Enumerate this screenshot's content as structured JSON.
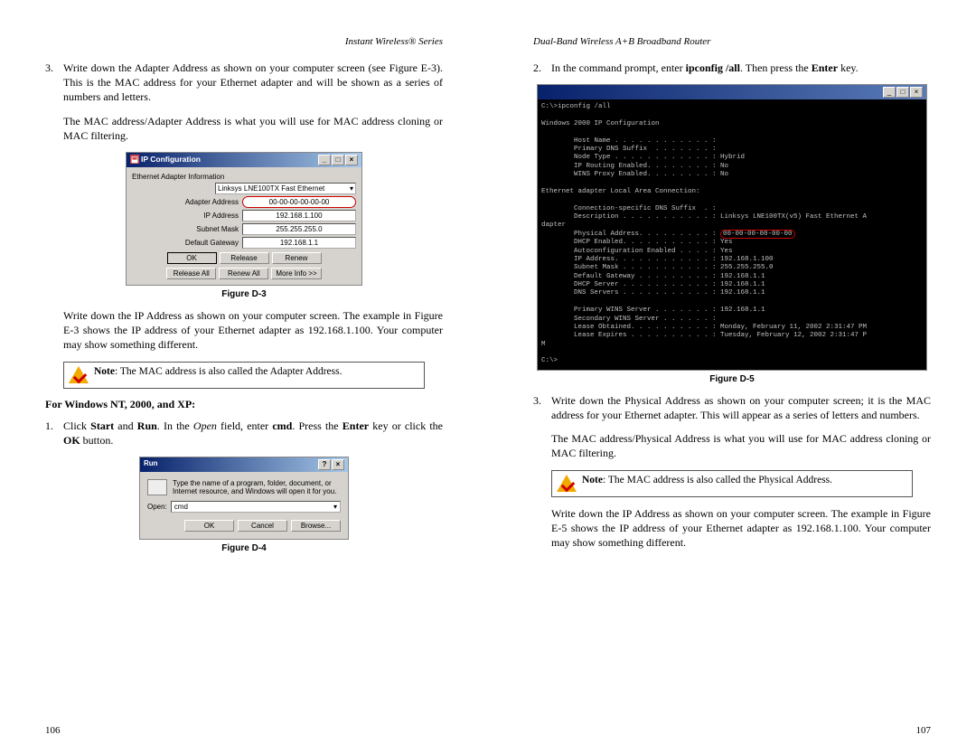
{
  "left": {
    "header": "Instant Wireless® Series",
    "step3_a": "Write down the Adapter Address as shown on your computer screen (see Figure E-3). This is the MAC address for your Ethernet adapter and will be shown as a series of numbers and letters.",
    "step3_b": "The MAC address/Adapter Address is what you will use for MAC address cloning or MAC filtering.",
    "d3_caption": "Figure D-3",
    "d3_title": "IP Configuration",
    "d3_group": "Ethernet Adapter Information",
    "d3_dd": "Linksys LNE100TX Fast Ethernet",
    "d3_r1l": "Adapter Address",
    "d3_r1v": "00-00-00-00-00-00",
    "d3_r2l": "IP Address",
    "d3_r2v": "192.168.1.100",
    "d3_r3l": "Subnet Mask",
    "d3_r3v": "255.255.255.0",
    "d3_r4l": "Default Gateway",
    "d3_r4v": "192.168.1.1",
    "d3_b1": "OK",
    "d3_b2": "Release",
    "d3_b3": "Renew",
    "d3_b4": "Release All",
    "d3_b5": "Renew All",
    "d3_b6": "More Info >>",
    "after_d3": "Write down the IP Address as shown on your computer screen. The example in Figure E-3 shows the IP address of your Ethernet adapter as 192.168.1.100. Your computer may show something different.",
    "note1_pre": "Note",
    "note1_text": ": The MAC address is also called the Adapter Address.",
    "section": "For Windows NT, 2000, and XP:",
    "step1_pre": "Click ",
    "step1_b1": "Start",
    "step1_mid1": " and ",
    "step1_b2": "Run",
    "step1_mid2": ". In the ",
    "step1_i": "Open",
    "step1_mid3": " field, enter ",
    "step1_b3": "cmd",
    "step1_mid4": ". Press the ",
    "step1_b4": "Enter",
    "step1_mid5": " key or click the ",
    "step1_b5": "OK",
    "step1_end": " button.",
    "d4_title": "Run",
    "d4_desc": "Type the name of a program, folder, document, or Internet resource, and Windows will open it for you.",
    "d4_open": "Open:",
    "d4_val": "cmd",
    "d4_b1": "OK",
    "d4_b2": "Cancel",
    "d4_b3": "Browse...",
    "d4_caption": "Figure D-4",
    "pagenum": "106"
  },
  "right": {
    "header": "Dual-Band Wireless A+B Broadband Router",
    "step2_pre": "In the command prompt, enter ",
    "step2_b1": "ipconfig /all",
    "step2_mid": ". Then press the ",
    "step2_b2": "Enter",
    "step2_end": " key.",
    "cmd_title": " ",
    "cmd_prompt": "C:\\>ipconfig /all",
    "cmd_h1": "Windows 2000 IP Configuration",
    "cmd_l1": "        Host Name . . . . . . . . . . . . :",
    "cmd_l2": "        Primary DNS Suffix  . . . . . . . :",
    "cmd_l3": "        Node Type . . . . . . . . . . . . : Hybrid",
    "cmd_l4": "        IP Routing Enabled. . . . . . . . : No",
    "cmd_l5": "        WINS Proxy Enabled. . . . . . . . : No",
    "cmd_h2": "Ethernet adapter Local Area Connection:",
    "cmd_l6": "        Connection-specific DNS Suffix  . :",
    "cmd_l7a": "        Description . . . . . . . . . . . : Linksys LNE100TX(v5) Fast Ethernet A",
    "cmd_l7b": "dapter",
    "cmd_l8a": "        Physical Address. . . . . . . . . : ",
    "cmd_l8b": "00-00-00-00-00-00",
    "cmd_l9": "        DHCP Enabled. . . . . . . . . . . : Yes",
    "cmd_l10": "        Autoconfiguration Enabled . . . . : Yes",
    "cmd_l11": "        IP Address. . . . . . . . . . . . : 192.168.1.100",
    "cmd_l12": "        Subnet Mask . . . . . . . . . . . : 255.255.255.0",
    "cmd_l13": "        Default Gateway . . . . . . . . . : 192.168.1.1",
    "cmd_l14": "        DHCP Server . . . . . . . . . . . : 192.168.1.1",
    "cmd_l15": "        DNS Servers . . . . . . . . . . . : 192.168.1.1",
    "cmd_l16": "        Primary WINS Server . . . . . . . : 192.168.1.1",
    "cmd_l17": "        Secondary WINS Server . . . . . . :",
    "cmd_l18": "        Lease Obtained. . . . . . . . . . : Monday, February 11, 2002 2:31:47 PM",
    "cmd_l19": "        Lease Expires . . . . . . . . . . : Tuesday, February 12, 2002 2:31:47 P",
    "cmd_l20": "M",
    "cmd_end": "C:\\>",
    "d5_caption": "Figure D-5",
    "step3": "Write down the Physical Address as shown on your computer screen; it is the MAC address for your Ethernet adapter.  This will appear as a series of letters and numbers.",
    "step3b": "The MAC address/Physical Address is what you will use for MAC address cloning or MAC filtering.",
    "note2_pre": "Note",
    "note2_text": ": The MAC address is also called the Physical Address.",
    "after": "Write down the IP Address as shown on your computer screen. The example in Figure E-5 shows the IP address of your Ethernet adapter as 192.168.1.100. Your computer may show something different.",
    "pagenum": "107"
  }
}
